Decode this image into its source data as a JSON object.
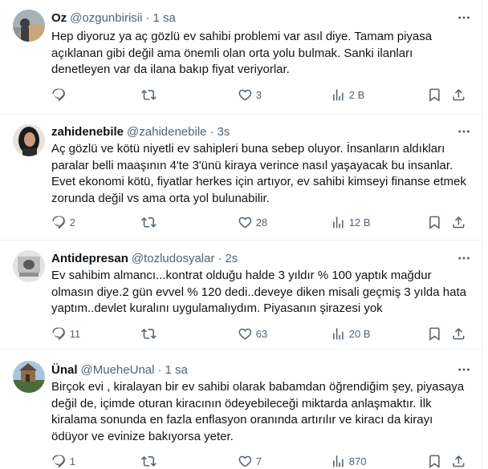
{
  "tweets": [
    {
      "name": "Oz",
      "handle": "@ozgunbirisii",
      "dot": "·",
      "time": "1 sa",
      "text": "Hep diyoruz ya aç gözlü ev sahibi problemi var asıl diye. Tamam piyasa açıklanan gibi değil ama önemli olan orta yolu bulmak. Sanki ilanları denetleyen var da ilana bakıp fiyat veriyorlar.",
      "replies": "",
      "retweets": "",
      "likes": "3",
      "views": "2 B",
      "avatar_colors": [
        "#6b7a86",
        "#c9a77a"
      ]
    },
    {
      "name": "zahidenebile",
      "handle": "@zahidenebile",
      "dot": "·",
      "time": "3s",
      "text": "Aç gözlü ve kötü niyetli ev sahipleri buna sebep oluyor. İnsanların aldıkları paralar belli maaşının 4'te 3'ünü kiraya verince nasıl yaşayacak bu insanlar. Evet ekonomi kötü, fiyatlar herkes için artıyor, ev sahibi kimseyi finanse etmek zorunda değil vs ama orta yol bulunabilir.",
      "replies": "2",
      "retweets": "",
      "likes": "28",
      "views": "12 B",
      "avatar_colors": [
        "#1c1c1c",
        "#e8e2da"
      ]
    },
    {
      "name": "Antidepresan",
      "handle": "@tozludosyalar",
      "dot": "·",
      "time": "2s",
      "text": "Ev sahibim almancı...kontrat olduğu halde 3 yıldır % 100 yaptık mağdur olmasın diye.2 gün evvel % 120 dedi..deveye diken misali geçmiş 3 yılda hata yaptım..devlet kuralını uygulamalıydım. Piyasanın şirazesi yok",
      "replies": "11",
      "retweets": "",
      "likes": "63",
      "views": "20 B",
      "avatar_colors": [
        "#d9d9d9",
        "#555555"
      ]
    },
    {
      "name": "Ünal",
      "handle": "@MueheUnal",
      "dot": "·",
      "time": "1 sa",
      "text": "Birçok evi , kiralayan bir ev sahibi olarak babamdan öğrendiğim şey, piyasaya değil de, içimde oturan kiracının ödeyebileceği miktarda anlaşmaktır. İlk kiralama sonunda en fazla enflasyon oranında artırılır ve kiracı da kirayı ödüyor ve evinize bakıyorsa yeter.",
      "replies": "1",
      "retweets": "",
      "likes": "7",
      "views": "870",
      "avatar_colors": [
        "#7fa6c9",
        "#4a6b3a"
      ]
    }
  ]
}
